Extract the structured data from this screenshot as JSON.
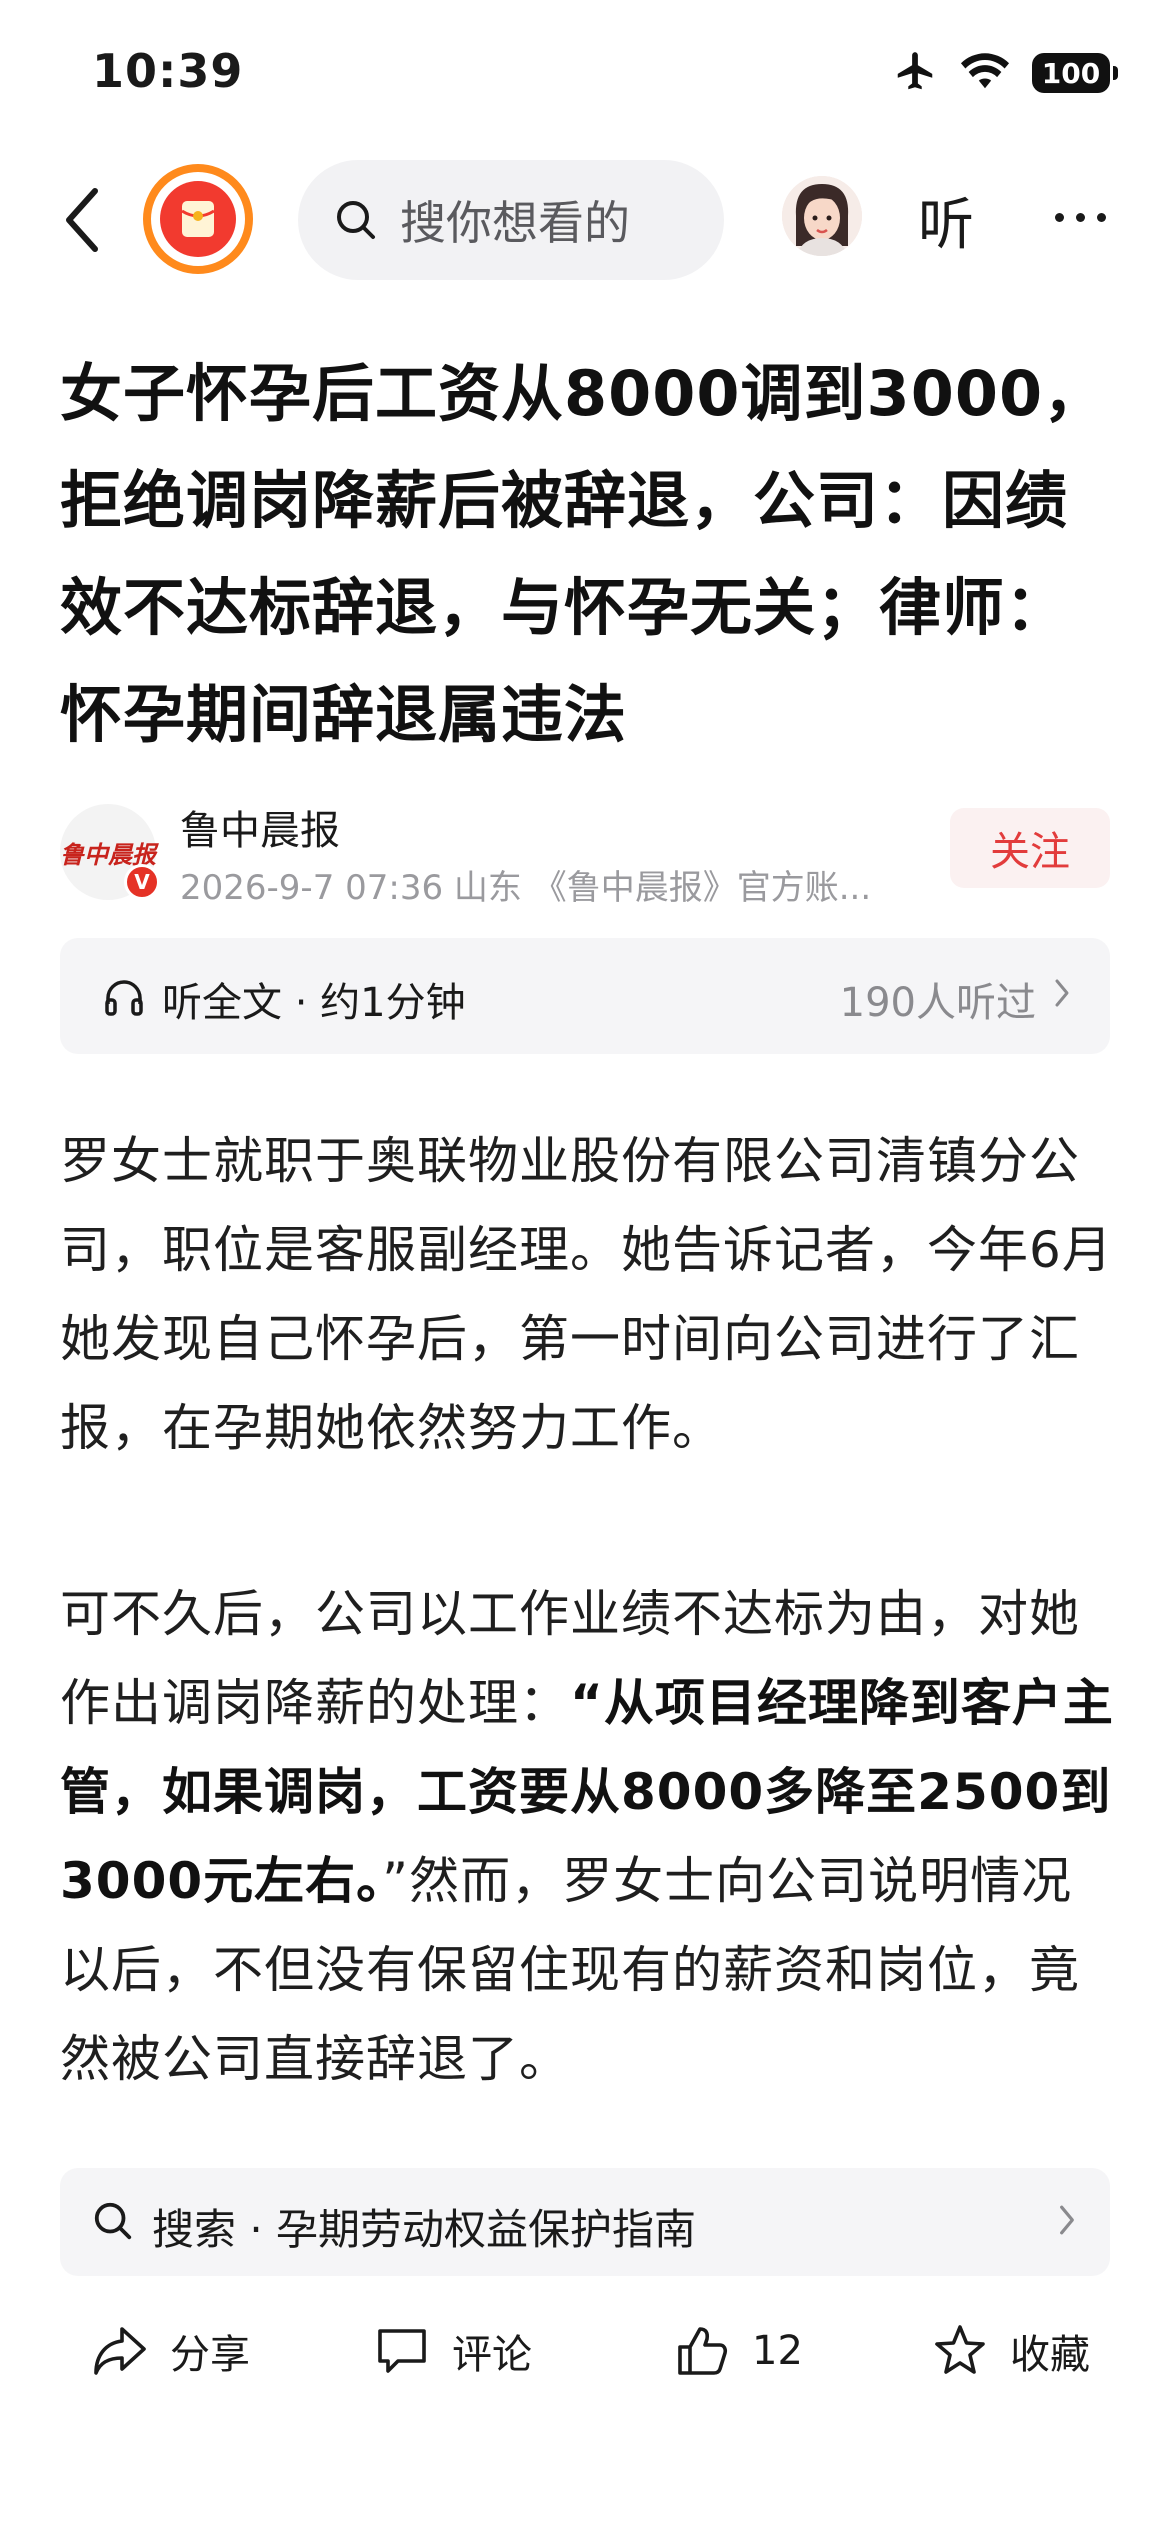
{
  "status_bar": {
    "time": "10:39",
    "battery": "100"
  },
  "nav": {
    "search_placeholder": "搜你想看的",
    "listen_label": "听"
  },
  "article": {
    "title": "女子怀孕后工资从8000调到3000，拒绝调岗降薪后被辞退，公司：因绩效不达标辞退，与怀孕无关；律师：怀孕期间辞退属违法",
    "author": {
      "name": "鲁中晨报",
      "logo_text": "鲁中晨报",
      "verified_mark": "V",
      "meta": "2026-9-7  07:36  山东  《鲁中晨报》官方账..."
    },
    "follow_label": "关注",
    "listen_bar": {
      "label": "听全文 · 约1分钟",
      "count": "190人听过"
    },
    "paragraphs": {
      "p1": "罗女士就职于奥联物业股份有限公司清镇分公司，职位是客服副经理。她告诉记者，今年6月她发现自己怀孕后，第一时间向公司进行了汇报，在孕期她依然努力工作。",
      "p2_before": "可不久后，公司以工作业绩不达标为由，对她作出调岗降薪的处理：",
      "p2_bold": "“从项目经理降到客户主管，如果调岗，工资要从8000多降至2500到3000元左右。",
      "p2_after": "”然而，罗女士向公司说明情况以后，不但没有保留住现有的薪资和岗位，竟然被公司直接辞退了。"
    }
  },
  "bottom_search": {
    "text": "搜索 · 孕期劳动权益保护指南"
  },
  "actions": {
    "share": "分享",
    "comment": "评论",
    "like_count": "12",
    "favorite": "收藏"
  }
}
